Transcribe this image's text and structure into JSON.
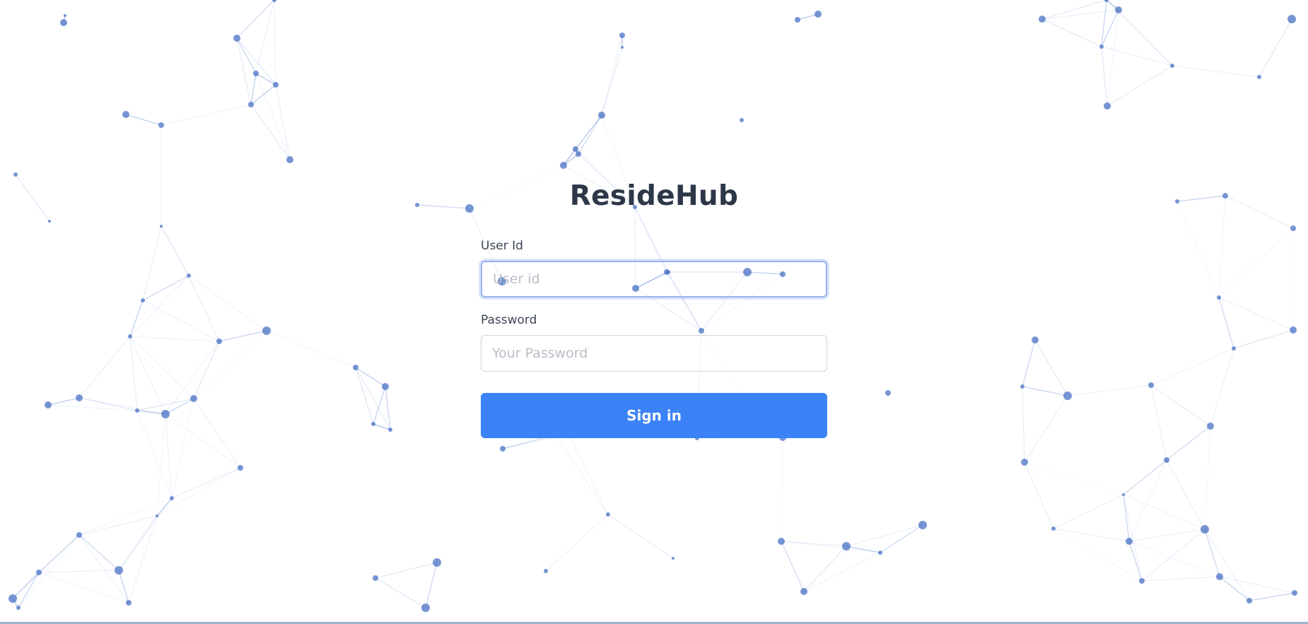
{
  "app": {
    "brand_name": "ResideHub"
  },
  "login_form": {
    "user_id": {
      "label": "User Id",
      "placeholder": "User id",
      "value": ""
    },
    "password": {
      "label": "Password",
      "placeholder": "Your Password",
      "value": ""
    },
    "sign_in_label": "Sign in"
  },
  "theme": {
    "accent": "#3b82f6",
    "title_color": "#2d3748",
    "network_node": "#4a72c4",
    "network_edge": "#6b8fd6"
  }
}
